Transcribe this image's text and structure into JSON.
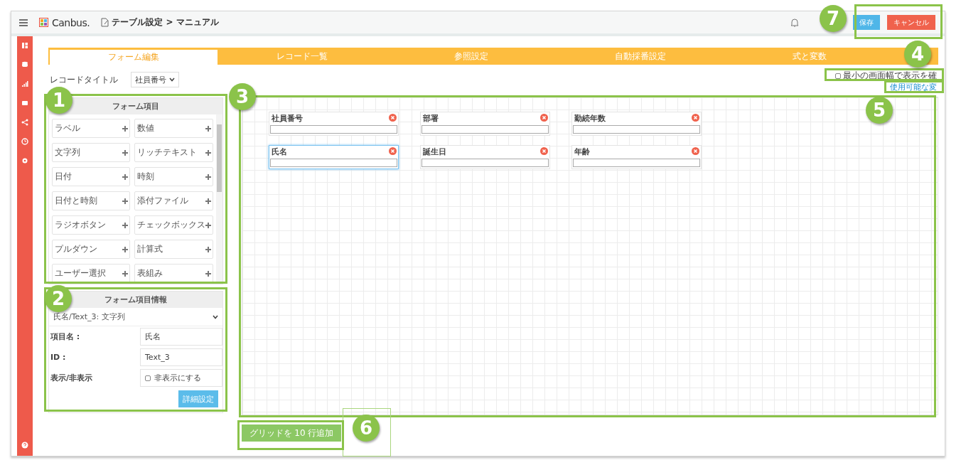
{
  "header": {
    "logo": "Canbus.",
    "title": "テーブル設定 > マニュアル",
    "buttons": [
      {
        "label": "保存",
        "kind": "save"
      },
      {
        "label": "キャンセル",
        "kind": "cancel"
      }
    ]
  },
  "tabs": [
    {
      "label": "フォーム編集",
      "selected": true
    },
    {
      "label": "レコード一覧",
      "selected": false
    },
    {
      "label": "参照設定",
      "selected": false
    },
    {
      "label": "自動採番設定",
      "selected": false
    },
    {
      "label": "式と変数",
      "selected": false
    }
  ],
  "record_title": {
    "label": "レコードタイトル",
    "value": "社員番号"
  },
  "form_items": {
    "title": "フォーム項目",
    "items": [
      "ラベル",
      "数値",
      "文字列",
      "リッチテキスト",
      "日付",
      "時刻",
      "日付と時刻",
      "添付ファイル",
      "ラジオボタン",
      "チェックボックス",
      "プルダウン",
      "計算式",
      "ユーザー選択",
      "表組み"
    ]
  },
  "item_info": {
    "title": "フォーム項目情報",
    "selector": "氏名/Text_3: 文字列",
    "fields": [
      {
        "label": "項目名 :",
        "kind": "text",
        "value": "氏名"
      },
      {
        "label": "ID :",
        "kind": "text",
        "value": "Text_3"
      },
      {
        "label": "表示/非表示",
        "kind": "checkbox",
        "option": "非表示にする",
        "checked": false
      }
    ],
    "button": "詳細設定"
  },
  "canvas_options": {
    "checkbox": {
      "label": "最小の画面幅で表示を確",
      "checked": false
    },
    "link": "使用可能な変"
  },
  "canvas_fields": [
    {
      "label": "社員番号",
      "selected": false
    },
    {
      "label": "部署",
      "selected": false
    },
    {
      "label": "勤続年数",
      "selected": false
    },
    {
      "label": "氏名",
      "selected": true
    },
    {
      "label": "誕生日",
      "selected": false
    },
    {
      "label": "年齢",
      "selected": false
    }
  ],
  "add_grid_button": "グリッドを 10 行追加",
  "annotations": [
    {
      "number": "1"
    },
    {
      "number": "2"
    },
    {
      "number": "3"
    },
    {
      "number": "4"
    },
    {
      "number": "5"
    },
    {
      "number": "6"
    },
    {
      "number": "7"
    }
  ]
}
